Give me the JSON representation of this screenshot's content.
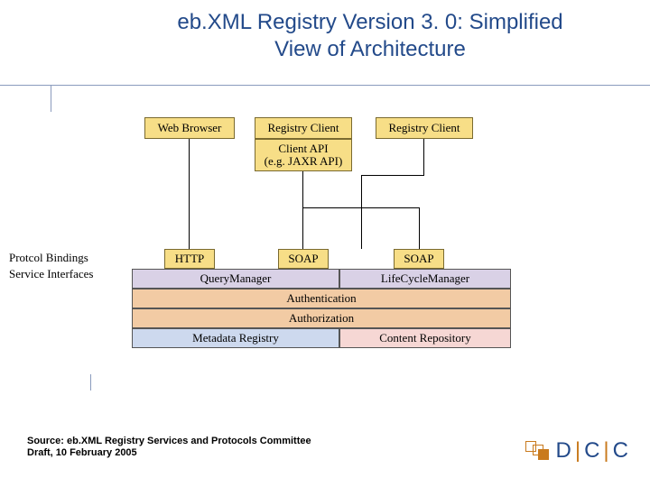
{
  "title": "eb.XML Registry Version 3. 0: Simplified View of Architecture",
  "top_row": {
    "web_browser": "Web Browser",
    "registry_client_1": "Registry Client",
    "registry_client_2": "Registry Client",
    "client_api_line1": "Client API",
    "client_api_line2": "(e.g. JAXR API)"
  },
  "side_labels": {
    "protocol_bindings": "Protcol Bindings",
    "service_interfaces": "Service Interfaces"
  },
  "protocol": {
    "http": "HTTP",
    "soap1": "SOAP",
    "soap2": "SOAP"
  },
  "managers": {
    "query": "QueryManager",
    "lifecycle": "LifeCycleManager"
  },
  "layers": {
    "auth": "Authentication",
    "authz": "Authorization",
    "metadata": "Metadata Registry",
    "content": "Content Repository"
  },
  "source": "Source: eb.XML Registry Services and Protocols Committee Draft, 10 February 2005",
  "logo": {
    "d": "D",
    "c1": "C",
    "c2": "C"
  }
}
